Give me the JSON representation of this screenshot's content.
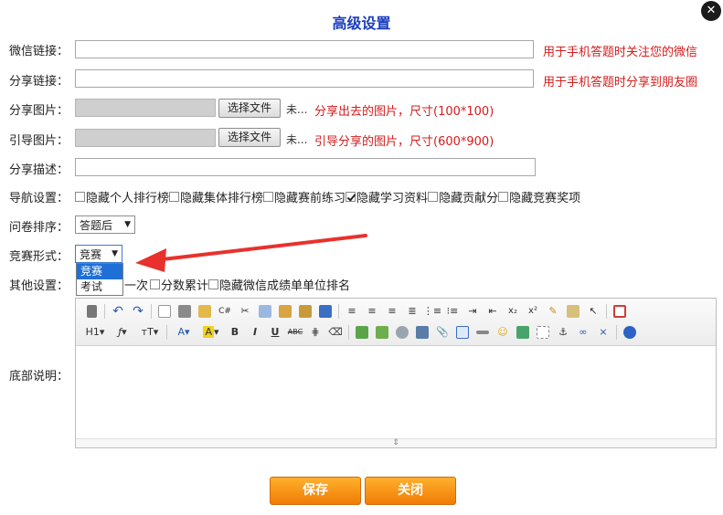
{
  "dialog": {
    "title": "高级设置",
    "close_symbol": "✕"
  },
  "wechat_link": {
    "label": "微信链接：",
    "value": "",
    "hint": "用于手机答题时关注您的微信"
  },
  "share_link": {
    "label": "分享链接：",
    "value": "",
    "hint": "用于手机答题时分享到朋友圈"
  },
  "share_image": {
    "label": "分享图片：",
    "button": "选择文件",
    "status": "未...",
    "hint": "分享出去的图片，尺寸(100*100)"
  },
  "guide_image": {
    "label": "引导图片：",
    "button": "选择文件",
    "status": "未...",
    "hint": "引导分享的图片，尺寸(600*900)"
  },
  "share_desc": {
    "label": "分享描述：",
    "value": ""
  },
  "nav_settings": {
    "label": "导航设置：",
    "options": [
      {
        "label": "隐藏个人排行榜",
        "checked": false
      },
      {
        "label": "隐藏集体排行榜",
        "checked": false
      },
      {
        "label": "隐藏赛前练习",
        "checked": false
      },
      {
        "label": "隐藏学习资料",
        "checked": true
      },
      {
        "label": "隐藏贡献分",
        "checked": false
      },
      {
        "label": "隐藏竞赛奖项",
        "checked": false
      }
    ]
  },
  "question_order": {
    "label": "问卷排序：",
    "value": "答题后"
  },
  "contest_form": {
    "label": "竞赛形式：",
    "value": "竞赛",
    "options": [
      "竞赛",
      "考试"
    ],
    "selected_index": 0
  },
  "other_settings": {
    "label": "其他设置：",
    "options": [
      {
        "label": "一次",
        "checked": false
      },
      {
        "label": "分数累计",
        "checked": false
      },
      {
        "label": "隐藏微信成绩单单位排名",
        "checked": false
      }
    ]
  },
  "bottom_desc": {
    "label": "底部说明："
  },
  "toolbar": {
    "h1": "H1",
    "font": "ƒ",
    "font_size": "тT",
    "font_color": "A",
    "bg_color": "A",
    "bold": "B",
    "italic": "I",
    "underline": "U",
    "strike": "ABC",
    "sup": "x²",
    "sub": "x₂",
    "code": "C#",
    "dropdown_arrow": "▾",
    "resize_glyph": "⇕"
  },
  "colors": {
    "accent_title": "#1a3cbf",
    "hint_red": "#d41c1c",
    "button_orange": "#f07c05",
    "arrow_red": "#e8312c"
  },
  "buttons": {
    "save": "保存",
    "close": "关闭"
  }
}
